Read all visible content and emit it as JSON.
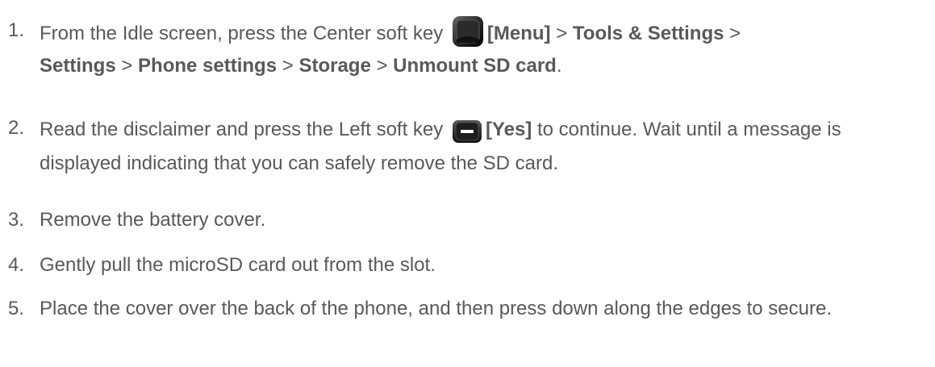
{
  "steps": [
    {
      "number": "1.",
      "parts": {
        "a": "From the Idle screen, press the Center soft key ",
        "b": "[Menu]",
        "c": " > ",
        "d": "Tools & Settings",
        "e": " > ",
        "f": "Settings",
        "g": " > ",
        "h": "Phone settings",
        "i": " > ",
        "j": "Storage",
        "k": " > ",
        "l": "Unmount SD card",
        "m": "."
      },
      "icon": "center-soft-key-icon"
    },
    {
      "number": "2.",
      "parts": {
        "a": "Read the disclaimer and press the Left soft key ",
        "b": "[Yes]",
        "c": " to continue. Wait until a message is displayed indicating that you can safely remove the SD card."
      },
      "icon": "left-soft-key-icon"
    },
    {
      "number": "3.",
      "text": "Remove the battery cover."
    },
    {
      "number": "4.",
      "text": "Gently pull the microSD card out from the slot."
    },
    {
      "number": "5.",
      "text": "Place the cover over the back of the phone, and then press down along the edges to secure."
    }
  ],
  "colors": {
    "body_text": "#595959",
    "key_dark": "#1a1a1a"
  }
}
